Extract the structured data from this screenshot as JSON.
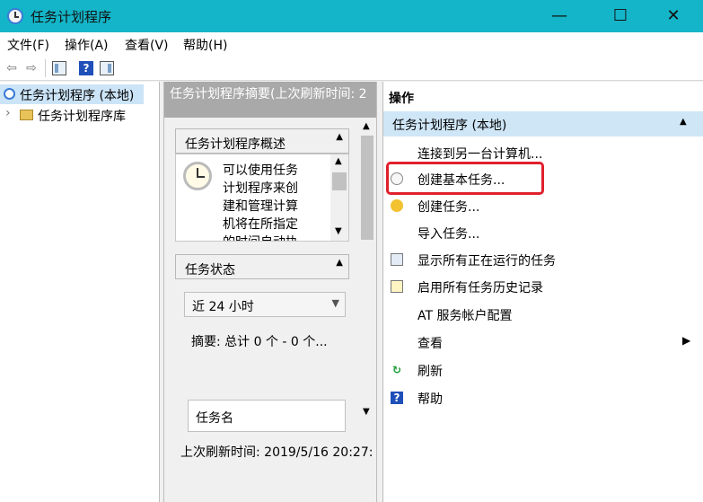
{
  "window": {
    "title": "任务计划程序",
    "minimize": "—",
    "maximize": "☐",
    "close": "✕"
  },
  "menu": [
    "文件(F)",
    "操作(A)",
    "查看(V)",
    "帮助(H)"
  ],
  "toolbar": {
    "back": "⇦",
    "forward": "⇨",
    "help": "?"
  },
  "tree": {
    "root": "任务计划程序 (本地)",
    "child": "任务计划程序库",
    "expander": "›"
  },
  "middle": {
    "header": "任务计划程序摘要(上次刷新时间: 2",
    "overview": {
      "title": "任务计划程序概述",
      "lines": [
        "可以使用任务",
        "计划程序来创",
        "建和管理计算",
        "机将在所指定",
        "的时间自动执"
      ]
    },
    "status": {
      "title": "任务状态",
      "dropdown": "近 24 小时",
      "summary": "摘要: 总计 0 个 - 0 个...",
      "column": "任务名"
    },
    "footer": "上次刷新时间: 2019/5/16 20:27:"
  },
  "actions": {
    "header": "操作",
    "group": "任务计划程序 (本地)",
    "items": [
      "连接到另一台计算机...",
      "创建基本任务...",
      "创建任务...",
      "导入任务...",
      "显示所有正在运行的任务",
      "启用所有任务历史记录",
      "AT 服务帐户配置",
      "查看",
      "刷新",
      "帮助"
    ]
  },
  "colors": {
    "titlebar": "#14b5c8",
    "highlight": "#e0202c",
    "group_bg": "#cfe6f7"
  }
}
